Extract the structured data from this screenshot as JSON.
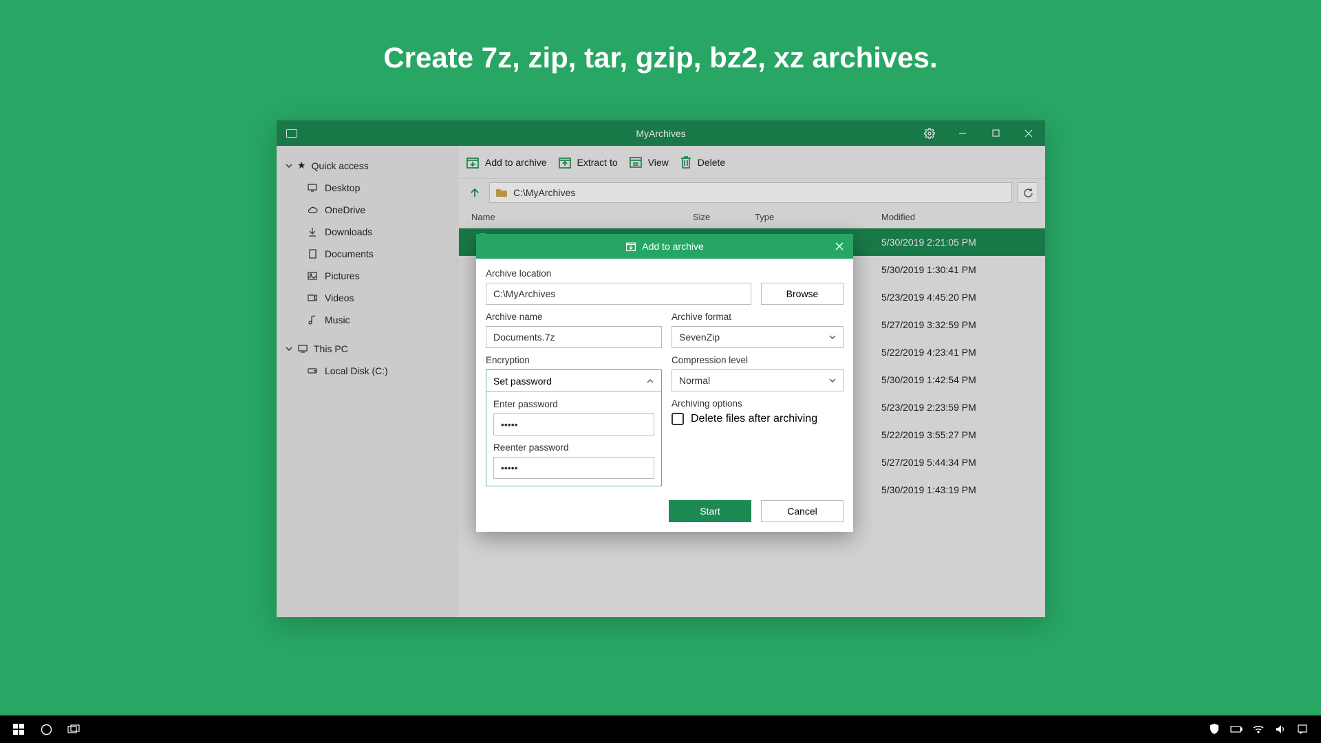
{
  "hero": "Create 7z, zip, tar, gzip, bz2, xz archives.",
  "window": {
    "title": "MyArchives"
  },
  "sidebar": {
    "quick_access": "Quick access",
    "items": [
      "Desktop",
      "OneDrive",
      "Downloads",
      "Documents",
      "Pictures",
      "Videos",
      "Music"
    ],
    "this_pc": "This PC",
    "local_disk": "Local Disk  (C:)"
  },
  "toolbar": {
    "add": "Add to archive",
    "extract": "Extract to",
    "view": "View",
    "delete": "Delete"
  },
  "path": "C:\\MyArchives",
  "columns": {
    "name": "Name",
    "size": "Size",
    "type": "Type",
    "modified": "Modified"
  },
  "rows": [
    {
      "modified": "5/30/2019 2:21:05 PM"
    },
    {
      "modified": "5/30/2019 1:30:41 PM"
    },
    {
      "modified": "5/23/2019 4:45:20 PM"
    },
    {
      "modified": "5/27/2019 3:32:59 PM"
    },
    {
      "modified": "5/22/2019 4:23:41 PM"
    },
    {
      "modified": "5/30/2019 1:42:54 PM"
    },
    {
      "modified": "5/23/2019 2:23:59 PM"
    },
    {
      "modified": "5/22/2019 3:55:27 PM"
    },
    {
      "modified": "5/27/2019 5:44:34 PM"
    },
    {
      "modified": "5/30/2019 1:43:19 PM"
    }
  ],
  "dialog": {
    "title": "Add to archive",
    "loc_label": "Archive location",
    "loc_value": "C:\\MyArchives",
    "browse": "Browse",
    "name_label": "Archive name",
    "name_value": "Documents.7z",
    "format_label": "Archive format",
    "format_value": "SevenZip",
    "encryption_label": "Encryption",
    "set_password": "Set password",
    "enter_pwd": "Enter password",
    "reenter_pwd": "Reenter password",
    "pwd_mask": "•••••",
    "compression_label": "Compression level",
    "compression_value": "Normal",
    "options_label": "Archiving options",
    "delete_after": "Delete files after archiving",
    "start": "Start",
    "cancel": "Cancel"
  }
}
